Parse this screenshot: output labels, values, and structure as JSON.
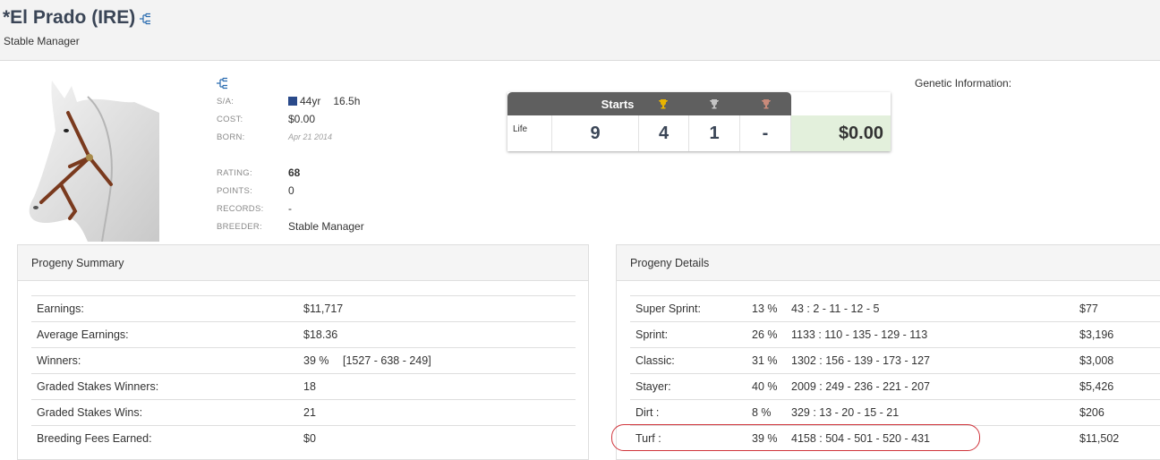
{
  "header": {
    "title": "*El Prado (IRE)",
    "subtitle": "Stable Manager"
  },
  "info": {
    "sa_label": "S/A:",
    "sa_age": "44yr",
    "sa_height": "16.5h",
    "cost_label": "COST:",
    "cost_value": "$0.00",
    "born_label": "BORN:",
    "born_value": "Apr 21 2014",
    "rating_label": "RATING:",
    "rating_value": "68",
    "points_label": "POINTS:",
    "points_value": "0",
    "records_label": "RECORDS:",
    "records_value": "-",
    "breeder_label": "BREEDER:",
    "breeder_value": "Stable Manager"
  },
  "stats": {
    "starts_label": "Starts",
    "row_label": "Life",
    "starts": "9",
    "first": "4",
    "second": "1",
    "third": "-",
    "earnings": "$0.00",
    "colors": {
      "gold": "#e8b400",
      "silver": "#c4c4c4",
      "bronze": "#c98a7a"
    }
  },
  "genetic": {
    "label": "Genetic Information:"
  },
  "progeny_summary": {
    "title": "Progeny Summary",
    "rows": [
      {
        "label": "Earnings:",
        "value": "$11,717"
      },
      {
        "label": "Average Earnings:",
        "value": "$18.36"
      },
      {
        "label": "Winners:",
        "value": "39 %",
        "extra": "[1527 - 638 - 249]"
      },
      {
        "label": "Graded Stakes Winners:",
        "value": "18"
      },
      {
        "label": "Graded Stakes Wins:",
        "value": "21"
      },
      {
        "label": "Breeding Fees Earned:",
        "value": "$0"
      }
    ]
  },
  "progeny_details": {
    "title": "Progeny Details",
    "rows": [
      {
        "label": "Super Sprint:",
        "pct": "13 %",
        "record": "43 : 2 - 11 - 12 - 5",
        "earnings": "$77"
      },
      {
        "label": "Sprint:",
        "pct": "26 %",
        "record": "1133 : 110 - 135 - 129 - 113",
        "earnings": "$3,196"
      },
      {
        "label": "Classic:",
        "pct": "31 %",
        "record": "1302 : 156 - 139 - 173 - 127",
        "earnings": "$3,008"
      },
      {
        "label": "Stayer:",
        "pct": "40 %",
        "record": "2009 : 249 - 236 - 221 - 207",
        "earnings": "$5,426"
      },
      {
        "label": "Dirt :",
        "pct": "8 %",
        "record": "329 : 13 - 20 - 15 - 21",
        "earnings": "$206"
      },
      {
        "label": "Turf :",
        "pct": "39 %",
        "record": "4158 : 504 - 501 - 520 - 431",
        "earnings": "$11,502"
      }
    ]
  },
  "icons": [
    "pedigree-icon",
    "flag-icon",
    "trophy-gold-icon",
    "trophy-silver-icon",
    "trophy-bronze-icon"
  ],
  "accent": {
    "highlight": "#d0343b",
    "title": "#3a4556",
    "money_bg": "#e3f0dc"
  }
}
